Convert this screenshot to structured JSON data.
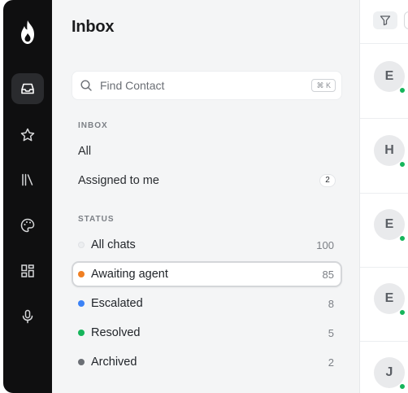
{
  "rail": {
    "icons": [
      "logo-flame-icon",
      "inbox-icon",
      "star-icon",
      "library-icon",
      "palette-icon",
      "dashboard-icon",
      "microphone-icon"
    ],
    "active": "inbox-icon"
  },
  "panel": {
    "title": "Inbox",
    "search": {
      "placeholder": "Find Contact",
      "shortcut": "⌘ K"
    },
    "inbox_section_label": "INBOX",
    "inbox_items": [
      {
        "label": "All",
        "count": null
      },
      {
        "label": "Assigned to me",
        "count": "2"
      }
    ],
    "status_section_label": "STATUS",
    "status_items": [
      {
        "label": "All chats",
        "count": "100",
        "dot_color": "#eceef0"
      },
      {
        "label": "Awaiting agent",
        "count": "85",
        "dot_color": "#f07f22",
        "selected": true
      },
      {
        "label": "Escalated",
        "count": "8",
        "dot_color": "#3b82f6"
      },
      {
        "label": "Resolved",
        "count": "5",
        "dot_color": "#16b55b"
      },
      {
        "label": "Archived",
        "count": "2",
        "dot_color": "#6b6f75"
      }
    ]
  },
  "conversation_list": {
    "avatars": [
      {
        "initial": "E",
        "online": true
      },
      {
        "initial": "H",
        "online": true
      },
      {
        "initial": "E",
        "online": true
      },
      {
        "initial": "E",
        "online": true
      },
      {
        "initial": "J",
        "online": true
      }
    ]
  },
  "colors": {
    "rail_bg": "#0f0f10",
    "panel_bg": "#f4f5f6",
    "online": "#16b55b"
  }
}
